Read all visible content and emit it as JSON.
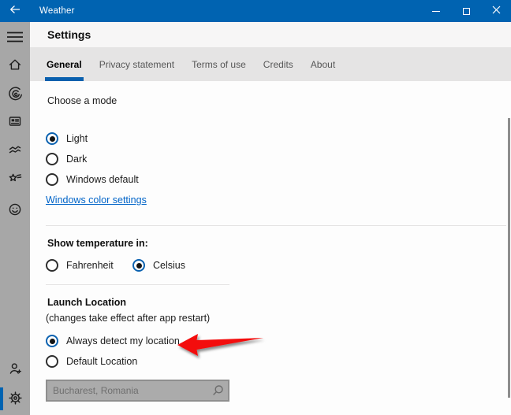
{
  "titlebar": {
    "title": "Weather",
    "icons": {
      "back": "arrow-left",
      "minimize": "dash",
      "maximize": "square-outline",
      "close": "x"
    }
  },
  "sidebar": {
    "items": [
      {
        "name": "menu",
        "icon": "hamburger-icon"
      },
      {
        "name": "forecast",
        "icon": "home-icon"
      },
      {
        "name": "maps",
        "icon": "radar-swirl-icon"
      },
      {
        "name": "news",
        "icon": "news-card-icon"
      },
      {
        "name": "historical-weather",
        "icon": "line-chart-icon"
      },
      {
        "name": "favorites",
        "icon": "star-list-icon"
      },
      {
        "name": "send-feedback",
        "icon": "smiley-icon"
      },
      {
        "name": "sign-in",
        "icon": "person-add-icon"
      },
      {
        "name": "settings",
        "icon": "gear-icon",
        "active": true
      }
    ]
  },
  "header": {
    "title": "Settings"
  },
  "tabs": [
    {
      "label": "General",
      "active": true
    },
    {
      "label": "Privacy statement",
      "active": false
    },
    {
      "label": "Terms of use",
      "active": false
    },
    {
      "label": "Credits",
      "active": false
    },
    {
      "label": "About",
      "active": false
    }
  ],
  "mode_section": {
    "heading": "Choose a mode",
    "options": [
      {
        "label": "Light",
        "selected": true
      },
      {
        "label": "Dark",
        "selected": false
      },
      {
        "label": "Windows default",
        "selected": false
      }
    ],
    "link_label": "Windows color settings"
  },
  "temperature_section": {
    "heading": "Show temperature in:",
    "options": [
      {
        "label": "Fahrenheit",
        "selected": false
      },
      {
        "label": "Celsius",
        "selected": true
      }
    ]
  },
  "location_section": {
    "heading": "Launch Location",
    "note": "(changes take effect after app restart)",
    "options": [
      {
        "label": "Always detect my location",
        "selected": true
      },
      {
        "label": "Default Location",
        "selected": false
      }
    ],
    "search_box": {
      "value": "Bucharest, Romania",
      "state": "disabled",
      "icon": "search-icon"
    }
  },
  "annotation": {
    "type": "red-arrow",
    "points_to": "Always detect my location",
    "color": "#F30C0C"
  },
  "colors": {
    "titlebar": "#0063B1",
    "accent": "#0063B1",
    "sidebar": "#A7A7A7",
    "tab_strip": "#E5E4E4",
    "link": "#0064C8",
    "radio_selected_ring": "#0B62B0",
    "arrow": "#F30C0C",
    "disabled_field_bg": "#ABABAB"
  }
}
